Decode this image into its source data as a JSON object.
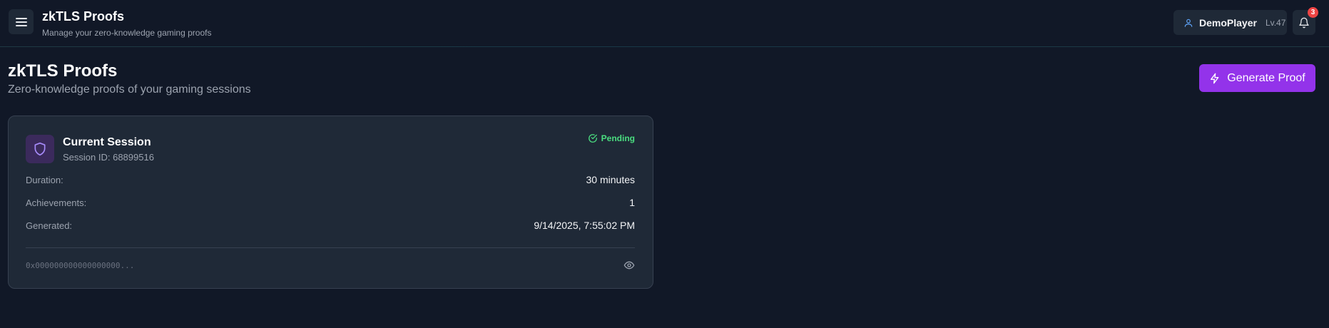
{
  "header": {
    "title": "zkTLS Proofs",
    "subtitle": "Manage your zero-knowledge gaming proofs",
    "user": {
      "name": "DemoPlayer",
      "level": "Lv.47"
    },
    "notifications_count": "3"
  },
  "page": {
    "title": "zkTLS Proofs",
    "subtitle": "Zero-knowledge proofs of your gaming sessions",
    "generate_label": "Generate Proof"
  },
  "proof_card": {
    "title": "Current Session",
    "session_id": "Session ID: 68899516",
    "status": "Pending",
    "rows": [
      {
        "label": "Duration:",
        "value": "30 minutes"
      },
      {
        "label": "Achievements:",
        "value": "1"
      },
      {
        "label": "Generated:",
        "value": "9/14/2025, 7:55:02 PM"
      }
    ],
    "hash": "0x000000000000000000..."
  },
  "colors": {
    "background": "#111827",
    "card": "#1f2937",
    "accent": "#9333ea",
    "status_pending": "#4ade80",
    "badge": "#ef4444"
  },
  "icons": [
    "menu-icon",
    "user-icon",
    "bell-icon",
    "zap-icon",
    "shield-icon",
    "check-circle-icon",
    "eye-icon"
  ]
}
